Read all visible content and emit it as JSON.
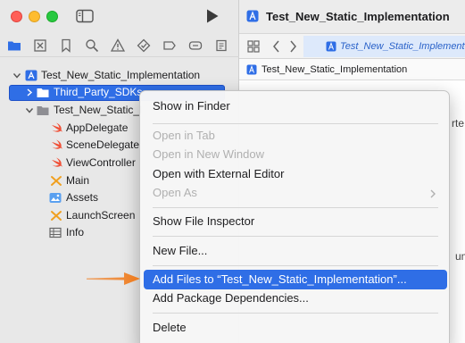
{
  "window": {
    "project_name": "Test_New_Static_Implementation"
  },
  "navigator": {
    "rows": [
      {
        "label": "Test_New_Static_Implementation"
      },
      {
        "label": "Third_Party_SDKs"
      },
      {
        "label": "Test_New_Static_I"
      },
      {
        "label": "AppDelegate"
      },
      {
        "label": "SceneDelegate"
      },
      {
        "label": "ViewController"
      },
      {
        "label": "Main"
      },
      {
        "label": "Assets"
      },
      {
        "label": "LaunchScreen"
      },
      {
        "label": "Info"
      }
    ]
  },
  "editor": {
    "title": "Test_New_Static_Implementation",
    "active_tab": "Test_New_Static_Implement",
    "jumpbar": "Test_New_Static_Implementation",
    "peek_text": [
      "rte",
      "um"
    ]
  },
  "context_menu": {
    "items": [
      {
        "label": "Show in Finder"
      },
      {
        "label": "Open in Tab"
      },
      {
        "label": "Open in New Window"
      },
      {
        "label": "Open with External Editor"
      },
      {
        "label": "Open As"
      },
      {
        "label": "Show File Inspector"
      },
      {
        "label": "New File..."
      },
      {
        "label": "Add Files to “Test_New_Static_Implementation”..."
      },
      {
        "label": "Add Package Dependencies..."
      },
      {
        "label": "Delete"
      }
    ]
  },
  "colors": {
    "selection": "#2f6ee6",
    "arrow": "#f07a1a",
    "swift": "#f05138"
  }
}
